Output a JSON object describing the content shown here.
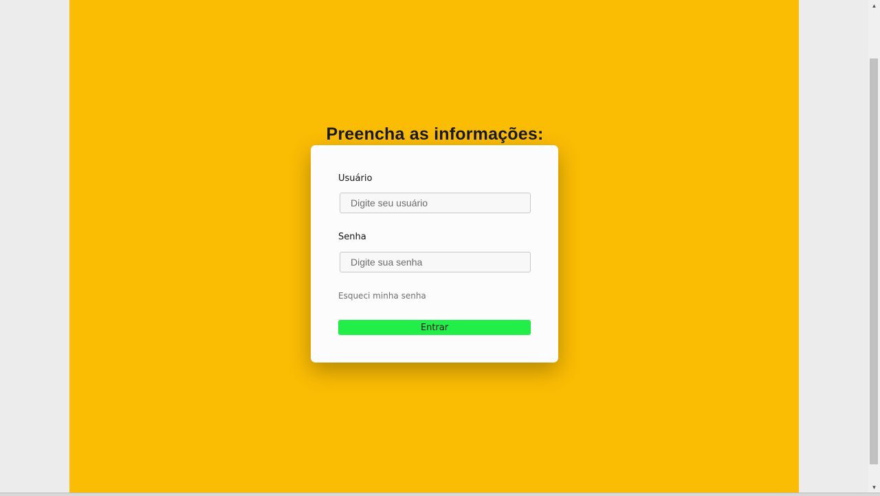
{
  "form": {
    "title": "Preencha as informações:",
    "user_label": "Usuário",
    "user_placeholder": "Digite seu usuário",
    "password_label": "Senha",
    "password_placeholder": "Digite sua senha",
    "forgot_label": "Esqueci minha senha",
    "submit_label": "Entrar"
  },
  "colors": {
    "background": "#fbbc04",
    "card": "#fcfcfc",
    "button": "#22ee4a"
  },
  "icons": {
    "scroll_up": "chevron-up-icon",
    "scroll_down": "chevron-down-icon"
  }
}
